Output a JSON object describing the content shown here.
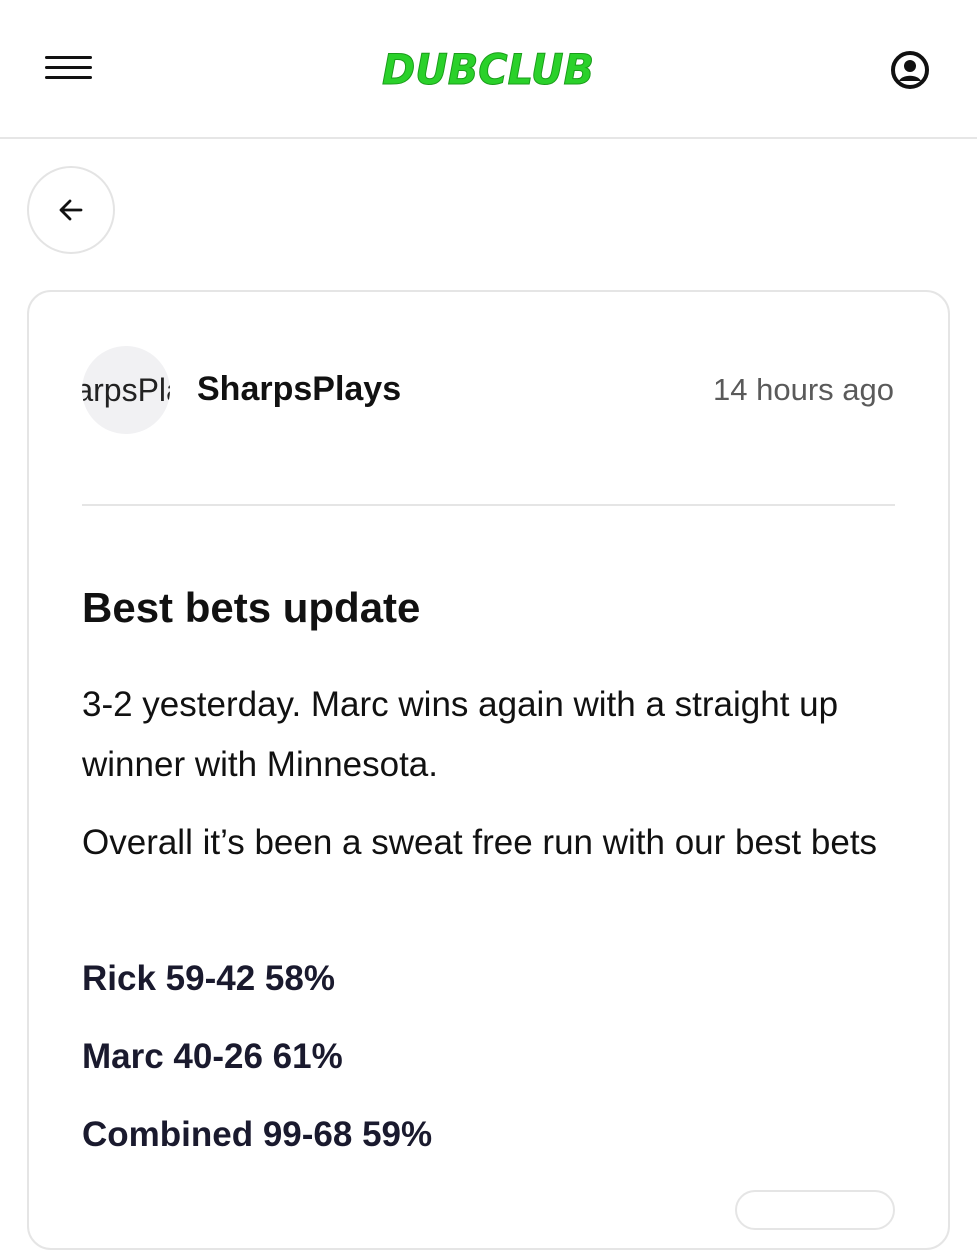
{
  "header": {
    "logo_text": "DUBCLUB",
    "logo_color": "#2ad12a",
    "menu_icon": "hamburger-icon",
    "profile_icon": "user-circle-icon"
  },
  "nav": {
    "back_icon": "arrow-left-icon"
  },
  "post": {
    "avatar_text": "SharpsPlays",
    "author": "SharpsPlays",
    "timestamp": "14 hours ago",
    "title": "Best bets update",
    "paragraphs": [
      "3-2 yesterday. Marc wins again with a straight up winner with Minnesota.",
      "Overall it’s been a sweat free run with our best bets"
    ],
    "stats": [
      "Rick 59-42 58%",
      "Marc 40-26 61%",
      "Combined 99-68 59%"
    ]
  }
}
